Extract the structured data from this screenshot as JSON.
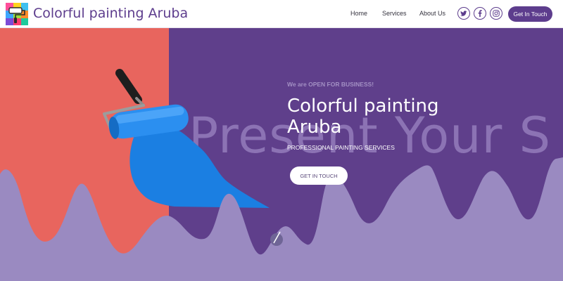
{
  "header": {
    "brand": "Colorful painting Aruba",
    "logo_icon": "paint-roller-logo-icon",
    "nav": [
      {
        "label": "Home"
      },
      {
        "label": "Services"
      },
      {
        "label": "About Us"
      }
    ],
    "social": [
      "twitter-icon",
      "facebook-icon",
      "instagram-icon"
    ],
    "cta_label": "Get In Touch"
  },
  "hero": {
    "background_word": "Present Your S",
    "eyebrow": "We are OPEN FOR BUSINESS!",
    "title": "Colorful painting Aruba",
    "subtitle": "PROFESSIONAL PAINTING SERVICES",
    "cta_label": "GET IN TOUCH",
    "roller_icon": "paint-roller-icon"
  },
  "colors": {
    "brand": "#5d3d8d",
    "hero_purple": "#5f3f8b",
    "hero_coral": "#e8655e",
    "wave_lavender": "#9a8ac1",
    "paint_blue": "#1b7fe2"
  }
}
